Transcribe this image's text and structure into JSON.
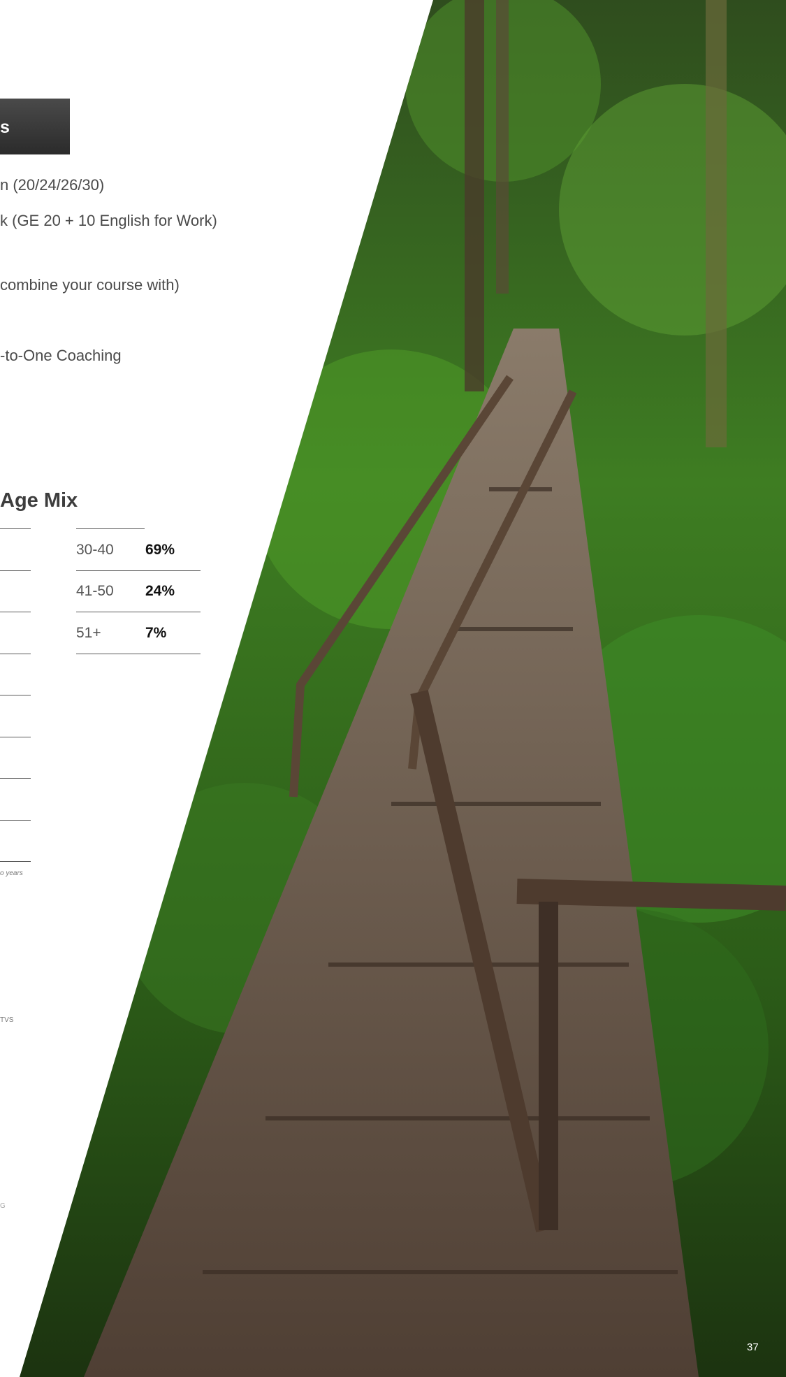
{
  "header": {
    "label": "s"
  },
  "lines": [
    "n (20/24/26/30)",
    "k (GE 20 + 10 English for Work)",
    "combine your course with)",
    "-to-One Coaching"
  ],
  "age_mix": {
    "title": "Age Mix",
    "rows": [
      {
        "range": "30-40",
        "percent": "69%"
      },
      {
        "range": "41-50",
        "percent": "24%"
      },
      {
        "range": "51+",
        "percent": "7%"
      }
    ]
  },
  "fragments": {
    "footnote": "o years",
    "tvs": "TVS",
    "g": "G"
  },
  "page_number": "37",
  "colors": {
    "header_box": "#333333",
    "forest_dark": "#1f3a14",
    "forest_green": "#3f8f24",
    "boardwalk": "#5e4a3a"
  }
}
